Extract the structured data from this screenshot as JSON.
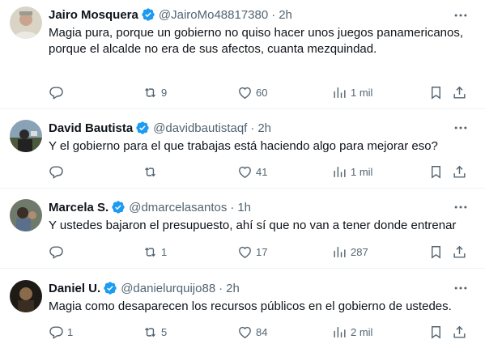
{
  "tweets": [
    {
      "name": "Jairo Mosquera",
      "handle": "@JairoMo48817380",
      "time": "2h",
      "text": "Magia pura, porque un gobierno no quiso hacer unos juegos panamericanos, porque el alcalde no era de sus afectos, cuanta mezquindad.",
      "replies": "",
      "retweets": "9",
      "likes": "60",
      "views": "1 mil"
    },
    {
      "name": "David Bautista",
      "handle": "@davidbautistaqf",
      "time": "2h",
      "text": "Y el gobierno para el que trabajas está haciendo algo para mejorar eso?",
      "replies": "",
      "retweets": "",
      "likes": "41",
      "views": "1 mil"
    },
    {
      "name": "Marcela S.",
      "handle": "@dmarcelasantos",
      "time": "1h",
      "text": "Y ustedes bajaron el presupuesto, ahí sí que no van a tener donde entrenar",
      "replies": "",
      "retweets": "1",
      "likes": "17",
      "views": "287"
    },
    {
      "name": "Daniel U.",
      "handle": "@danielurquijo88",
      "time": "2h",
      "text": "Magia como desaparecen los recursos públicos en el gobierno de ustedes.",
      "replies": "1",
      "retweets": "5",
      "likes": "84",
      "views": "2 mil"
    }
  ],
  "separator": "·",
  "icons": {
    "verified": "verified-badge-icon",
    "more": "more-dots-icon",
    "reply": "reply-icon",
    "retweet": "retweet-icon",
    "like": "heart-icon",
    "views": "views-icon",
    "bookmark": "bookmark-icon",
    "share": "share-icon"
  },
  "colors": {
    "verified": "#1d9bf0",
    "text": "#0f1419",
    "secondary": "#536471",
    "border": "#eff3f4"
  }
}
